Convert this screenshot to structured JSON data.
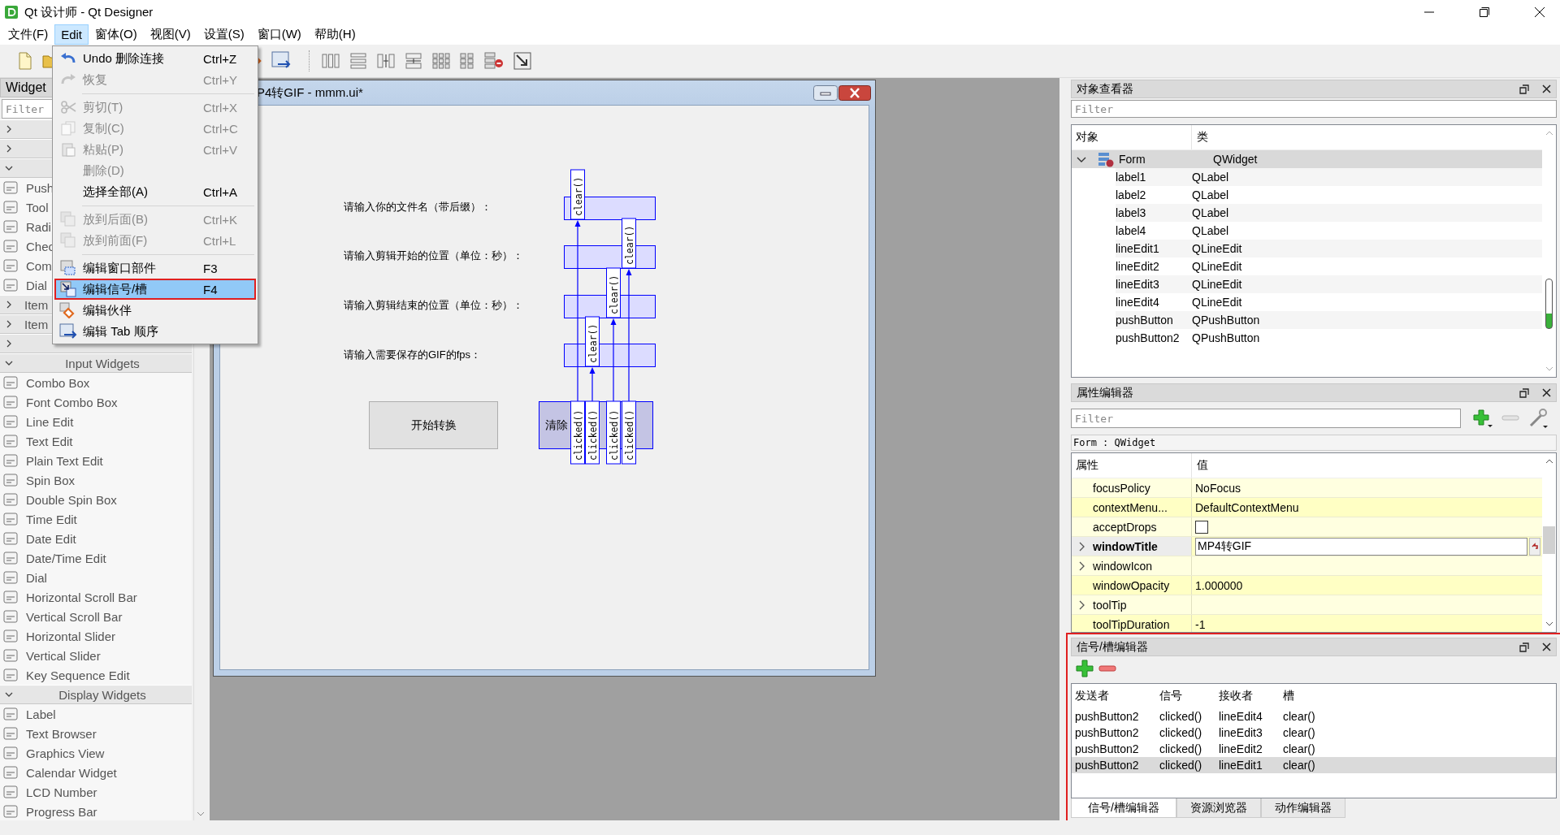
{
  "window": {
    "title": "Qt 设计师 - Qt Designer"
  },
  "menu_bar": [
    {
      "label": "文件(F)",
      "selected": false
    },
    {
      "label": "Edit",
      "selected": true
    },
    {
      "label": "窗体(O)",
      "selected": false
    },
    {
      "label": "视图(V)",
      "selected": false
    },
    {
      "label": "设置(S)",
      "selected": false
    },
    {
      "label": "窗口(W)",
      "selected": false
    },
    {
      "label": "帮助(H)",
      "selected": false
    }
  ],
  "edit_menu": {
    "items": [
      {
        "kind": "action",
        "label": "Undo 删除连接",
        "shortcut": "Ctrl+Z",
        "disabled": false,
        "selected": false,
        "framed": false
      },
      {
        "kind": "action",
        "label": "恢复",
        "shortcut": "Ctrl+Y",
        "disabled": true,
        "selected": false,
        "framed": false
      },
      {
        "kind": "separator"
      },
      {
        "kind": "action",
        "label": "剪切(T)",
        "shortcut": "Ctrl+X",
        "disabled": true,
        "selected": false,
        "framed": false
      },
      {
        "kind": "action",
        "label": "复制(C)",
        "shortcut": "Ctrl+C",
        "disabled": true,
        "selected": false,
        "framed": false
      },
      {
        "kind": "action",
        "label": "粘贴(P)",
        "shortcut": "Ctrl+V",
        "disabled": true,
        "selected": false,
        "framed": false
      },
      {
        "kind": "action",
        "label": "删除(D)",
        "disabled": true,
        "selected": false,
        "framed": false
      },
      {
        "kind": "action",
        "label": "选择全部(A)",
        "shortcut": "Ctrl+A",
        "disabled": false,
        "selected": false,
        "framed": false
      },
      {
        "kind": "separator"
      },
      {
        "kind": "action",
        "label": "放到后面(B)",
        "shortcut": "Ctrl+K",
        "disabled": true,
        "selected": false,
        "framed": false
      },
      {
        "kind": "action",
        "label": "放到前面(F)",
        "shortcut": "Ctrl+L",
        "disabled": true,
        "selected": false,
        "framed": false
      },
      {
        "kind": "separator"
      },
      {
        "kind": "action",
        "label": "编辑窗口部件",
        "shortcut": "F3",
        "disabled": false,
        "selected": false,
        "framed": false
      },
      {
        "kind": "action",
        "label": "编辑信号/槽",
        "shortcut": "F4",
        "disabled": false,
        "selected": true,
        "framed": true
      },
      {
        "kind": "action",
        "label": "编辑伙伴",
        "disabled": false,
        "selected": false,
        "framed": false
      },
      {
        "kind": "action",
        "label": "编辑 Tab 顺序",
        "disabled": false,
        "selected": false,
        "framed": false
      }
    ]
  },
  "widget_box": {
    "title": "Widget",
    "filter_placeholder": "Filter",
    "categories": [
      {
        "expanded": false
      },
      {
        "expanded": false
      },
      {
        "expanded": true,
        "items": [
          {
            "label": "Push"
          },
          {
            "label": "Tool"
          },
          {
            "label": "Radi"
          },
          {
            "label": "Chec"
          },
          {
            "label": "Com"
          },
          {
            "label": "Dial"
          }
        ]
      },
      {
        "label": "Item",
        "expanded": false
      },
      {
        "label": "Item",
        "expanded": false
      },
      {
        "expanded": false
      },
      {
        "label": "Input Widgets",
        "expanded": true,
        "items": [
          {
            "label": "Combo Box"
          },
          {
            "label": "Font Combo Box"
          },
          {
            "label": "Line Edit"
          },
          {
            "label": "Text Edit"
          },
          {
            "label": "Plain Text Edit"
          },
          {
            "label": "Spin Box"
          },
          {
            "label": "Double Spin Box"
          },
          {
            "label": "Time Edit"
          },
          {
            "label": "Date Edit"
          },
          {
            "label": "Date/Time Edit"
          },
          {
            "label": "Dial"
          },
          {
            "label": "Horizontal Scroll Bar"
          },
          {
            "label": "Vertical Scroll Bar"
          },
          {
            "label": "Horizontal Slider"
          },
          {
            "label": "Vertical Slider"
          },
          {
            "label": "Key Sequence Edit"
          }
        ]
      },
      {
        "label": "Display Widgets",
        "expanded": true,
        "items": [
          {
            "label": "Label"
          },
          {
            "label": "Text Browser"
          },
          {
            "label": "Graphics View"
          },
          {
            "label": "Calendar Widget"
          },
          {
            "label": "LCD Number"
          },
          {
            "label": "Progress Bar"
          }
        ]
      }
    ]
  },
  "form_window": {
    "title": "P4转GIF - mmm.ui*",
    "rows": [
      {
        "label": "请输入你的文件名（带后缀）：",
        "highlighted": true
      },
      {
        "label": "请输入剪辑开始的位置（单位：秒）：",
        "highlighted": true
      },
      {
        "label": "请输入剪辑结束的位置（单位：秒）：",
        "highlighted": true
      },
      {
        "label": "请输入需要保存的GIF的fps：",
        "highlighted": true
      }
    ],
    "buttons": [
      {
        "label": "开始转换",
        "highlighted": false
      },
      {
        "label": "清除",
        "highlighted": true
      }
    ],
    "connections": [
      {
        "signal": "clicked()",
        "slot": "clear()"
      },
      {
        "signal": "clicked()",
        "slot": "clear()"
      },
      {
        "signal": "clicked()",
        "slot": "clear()"
      },
      {
        "signal": "clicked()",
        "slot": "clear()"
      }
    ]
  },
  "object_inspector": {
    "title": "对象查看器",
    "filter_placeholder": "Filter",
    "columns": [
      "对象",
      "类"
    ],
    "tree": [
      {
        "name": "Form",
        "class": "QWidget",
        "expanded": true,
        "selected": true,
        "children": [
          {
            "name": "label1",
            "class": "QLabel",
            "selected": false
          },
          {
            "name": "label2",
            "class": "QLabel",
            "selected": false
          },
          {
            "name": "label3",
            "class": "QLabel",
            "selected": false
          },
          {
            "name": "label4",
            "class": "QLabel",
            "selected": false
          },
          {
            "name": "lineEdit1",
            "class": "QLineEdit",
            "selected": false
          },
          {
            "name": "lineEdit2",
            "class": "QLineEdit",
            "selected": false
          },
          {
            "name": "lineEdit3",
            "class": "QLineEdit",
            "selected": false
          },
          {
            "name": "lineEdit4",
            "class": "QLineEdit",
            "selected": false
          },
          {
            "name": "pushButton",
            "class": "QPushButton",
            "selected": false
          },
          {
            "name": "pushButton2",
            "class": "QPushButton",
            "selected": false
          }
        ]
      }
    ]
  },
  "property_editor": {
    "title": "属性编辑器",
    "filter_placeholder": "Filter",
    "object": "Form : QWidget",
    "columns": [
      "属性",
      "值"
    ],
    "properties": [
      {
        "name": "focusPolicy",
        "kind": "text",
        "value": "NoFocus",
        "expandable": false,
        "modified": false
      },
      {
        "name": "contextMenu...",
        "kind": "text",
        "value": "DefaultContextMenu",
        "expandable": false,
        "modified": false
      },
      {
        "name": "acceptDrops",
        "kind": "checkbox",
        "checked": false,
        "expandable": false,
        "modified": false
      },
      {
        "name": "windowTitle",
        "kind": "editor",
        "value": "MP4转GIF",
        "expandable": true,
        "modified": true
      },
      {
        "name": "windowIcon",
        "kind": "text",
        "expandable": true,
        "modified": false
      },
      {
        "name": "windowOpacity",
        "kind": "text",
        "value": "1.000000",
        "expandable": false,
        "modified": false
      },
      {
        "name": "toolTip",
        "kind": "text",
        "expandable": true,
        "modified": false
      },
      {
        "name": "toolTipDuration",
        "kind": "text",
        "value": "-1",
        "expandable": false,
        "modified": false
      }
    ]
  },
  "signal_slot_editor": {
    "title": "信号/槽编辑器",
    "framed": true,
    "columns": [
      "发送者",
      "信号",
      "接收者",
      "槽"
    ],
    "rows": [
      {
        "sender": "pushButton2",
        "signal": "clicked()",
        "receiver": "lineEdit4",
        "slot": "clear()",
        "selected": false
      },
      {
        "sender": "pushButton2",
        "signal": "clicked()",
        "receiver": "lineEdit3",
        "slot": "clear()",
        "selected": false
      },
      {
        "sender": "pushButton2",
        "signal": "clicked()",
        "receiver": "lineEdit2",
        "slot": "clear()",
        "selected": false
      },
      {
        "sender": "pushButton2",
        "signal": "clicked()",
        "receiver": "lineEdit1",
        "slot": "clear()",
        "selected": true
      }
    ],
    "tabs": [
      {
        "label": "信号/槽编辑器",
        "selected": true
      },
      {
        "label": "资源浏览器",
        "selected": false
      },
      {
        "label": "动作编辑器",
        "selected": false
      }
    ]
  }
}
